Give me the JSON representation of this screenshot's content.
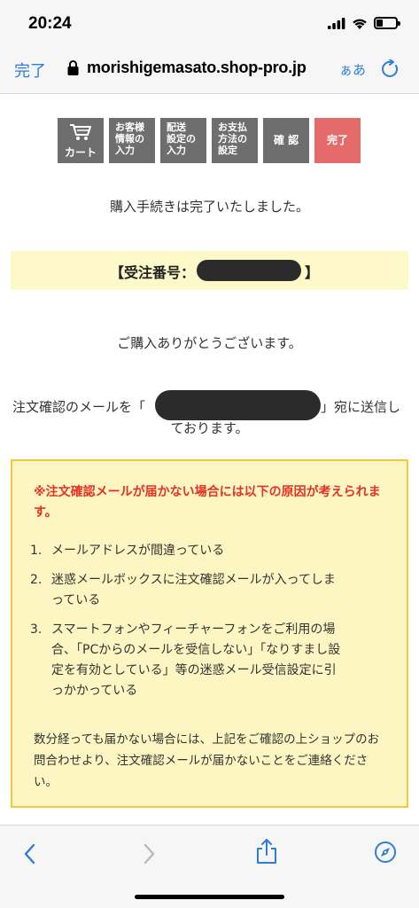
{
  "status": {
    "time": "20:24",
    "battery_level": 0.35
  },
  "browser": {
    "done_label": "完了",
    "url": "morishigemasato.shop-pro.jp",
    "text_size_label": "ぁあ"
  },
  "steps": [
    {
      "label": "カート",
      "icon": "cart-icon"
    },
    {
      "line1": "お客様",
      "line2": "情報の",
      "line3": "入力"
    },
    {
      "line1": "配送",
      "line2": "設定の",
      "line3": "入力"
    },
    {
      "line1": "お支払",
      "line2": "方法の",
      "line3": "設定"
    },
    {
      "label": "確 認"
    },
    {
      "label": "完了",
      "active": true
    }
  ],
  "page": {
    "complete_message": "購入手続きは完了いたしました。",
    "order_label": "【受注番号：",
    "order_close": "】",
    "thanks": "ご購入ありがとうございます。",
    "mail_line1_pre": "注文確認のメールを「",
    "mail_line1_post": "」宛に送信し",
    "mail_line2": "ております。"
  },
  "warning": {
    "title": "※注文確認メールが届かない場合には以下の原因が考えられます。",
    "items": [
      {
        "num": "1.",
        "text": "メールアドレスが間違っている"
      },
      {
        "num": "2.",
        "text": "迷惑メールボックスに注文確認メールが入ってしまっている"
      },
      {
        "num": "3.",
        "text": "スマートフォンやフィーチャーフォンをご利用の場合、「PCからのメールを受信しない」「なりすまし設定を有効としている」等の迷惑メール受信設定に引っかかっている"
      }
    ],
    "footer": "数分経っても届かない場合には、上記をご確認の上ショップのお問合わせより、注文確認メールが届かないことをご連絡ください。"
  },
  "colors": {
    "accent": "#2e7dd8",
    "step_gray": "#6e6e6e",
    "step_active": "#e56a6a",
    "warning_red": "#e53224",
    "highlight_yellow": "#fdf9c9",
    "warning_border": "#f3c93a"
  }
}
